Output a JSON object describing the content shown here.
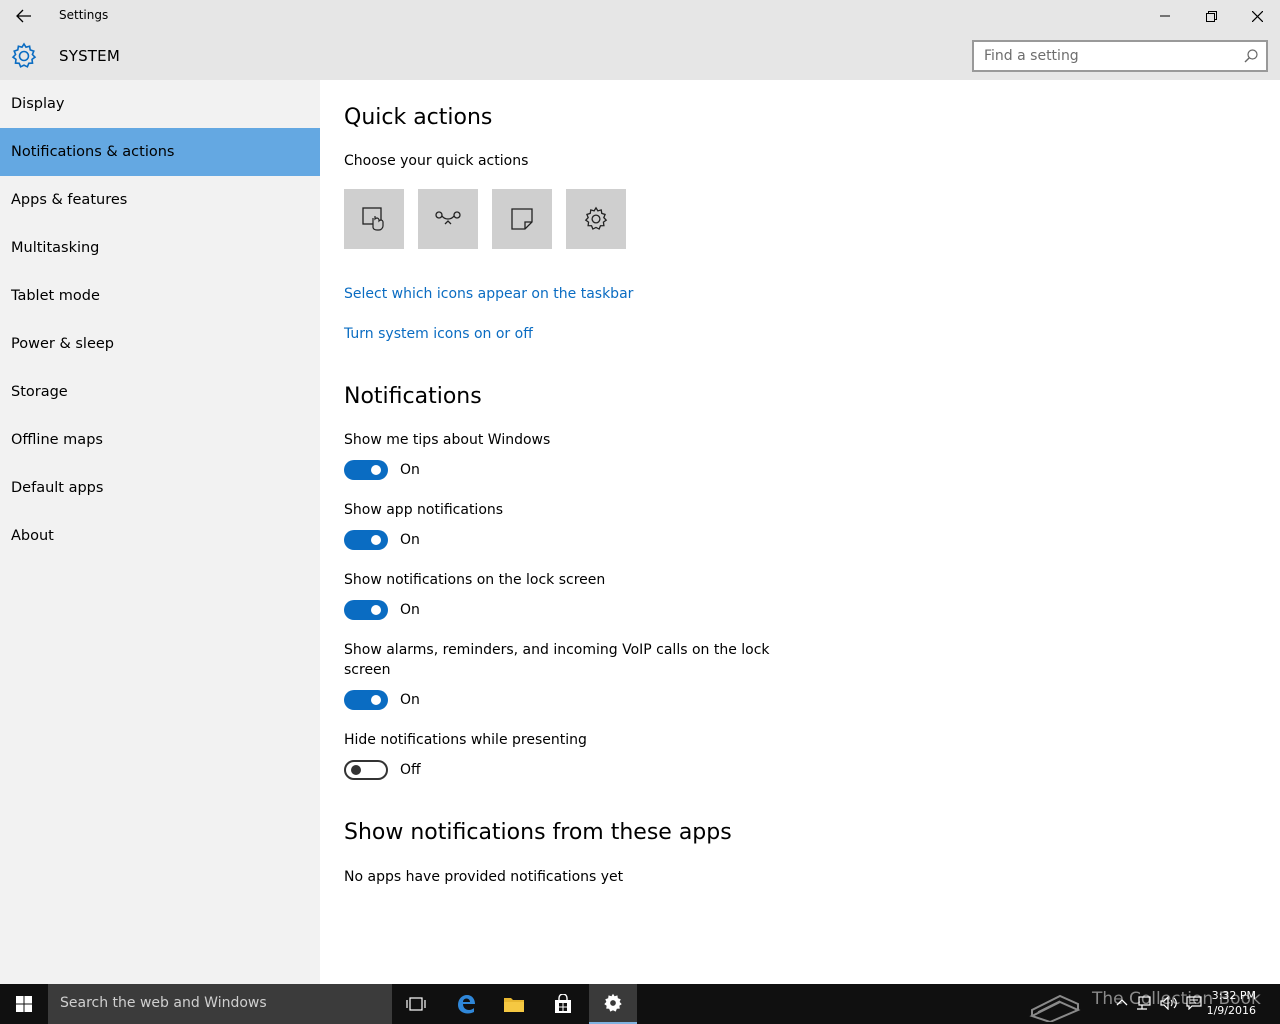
{
  "window": {
    "title": "Settings"
  },
  "header": {
    "section": "SYSTEM",
    "search_placeholder": "Find a setting"
  },
  "sidebar": {
    "items": [
      {
        "label": "Display",
        "active": false
      },
      {
        "label": "Notifications & actions",
        "active": true
      },
      {
        "label": "Apps & features",
        "active": false
      },
      {
        "label": "Multitasking",
        "active": false
      },
      {
        "label": "Tablet mode",
        "active": false
      },
      {
        "label": "Power & sleep",
        "active": false
      },
      {
        "label": "Storage",
        "active": false
      },
      {
        "label": "Offline maps",
        "active": false
      },
      {
        "label": "Default apps",
        "active": false
      },
      {
        "label": "About",
        "active": false
      }
    ]
  },
  "main": {
    "quick_actions": {
      "heading": "Quick actions",
      "subheading": "Choose your quick actions",
      "tiles": [
        "tablet-mode-icon",
        "connect-icon",
        "note-icon",
        "settings-icon"
      ],
      "link_taskbar": "Select which icons appear on the taskbar",
      "link_system_icons": "Turn system icons on or off"
    },
    "notifications": {
      "heading": "Notifications",
      "settings": [
        {
          "label": "Show me tips about Windows",
          "state": "On",
          "on": true
        },
        {
          "label": "Show app notifications",
          "state": "On",
          "on": true
        },
        {
          "label": "Show notifications on the lock screen",
          "state": "On",
          "on": true
        },
        {
          "label_line1": "Show alarms, reminders, and incoming VoIP calls on the lock",
          "label_line2": "screen",
          "state": "On",
          "on": true
        },
        {
          "label": "Hide notifications while presenting",
          "state": "Off",
          "on": false
        }
      ]
    },
    "apps": {
      "heading": "Show notifications from these apps",
      "empty_text": "No apps have provided notifications yet"
    }
  },
  "taskbar": {
    "search_placeholder": "Search the web and Windows",
    "time": "3:32 PM",
    "date": "1/9/2016",
    "watermark": "The Collection Book"
  },
  "colors": {
    "accent": "#0a6cc2",
    "nav_active": "#64a8e2",
    "sidebar_bg": "#f2f2f2",
    "titlebar_bg": "#e6e6e6"
  }
}
